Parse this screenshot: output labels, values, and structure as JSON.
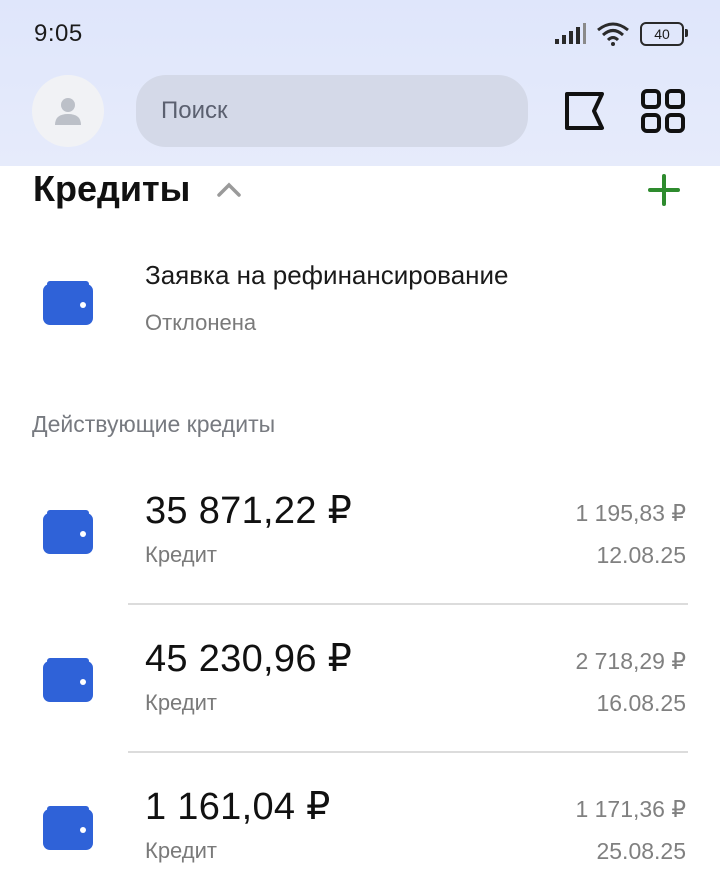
{
  "status_bar": {
    "time": "9:05",
    "battery": "40"
  },
  "header": {
    "search_placeholder": "Поиск"
  },
  "section": {
    "title": "Кредиты",
    "application": {
      "title": "Заявка на рефинансирование",
      "status": "Отклонена"
    },
    "active_label": "Действующие кредиты",
    "loans": [
      {
        "amount": "35 871,22 ₽",
        "type": "Кредит",
        "payment": "1 195,83 ₽",
        "date": "12.08.25"
      },
      {
        "amount": "45 230,96 ₽",
        "type": "Кредит",
        "payment": "2 718,29 ₽",
        "date": "16.08.25"
      },
      {
        "amount": "1 161,04 ₽",
        "type": "Кредит",
        "payment": "1 171,36 ₽",
        "date": "25.08.25"
      }
    ]
  },
  "colors": {
    "accent_blue": "#2f62d8",
    "plus_green": "#2e8b2e",
    "header_bg": "#e1e7fa"
  },
  "icons": [
    "person-icon",
    "flag-icon",
    "grid-icon",
    "chevron-up-icon",
    "plus-icon",
    "wallet-icon",
    "signal-icon",
    "wifi-icon",
    "battery-icon"
  ]
}
